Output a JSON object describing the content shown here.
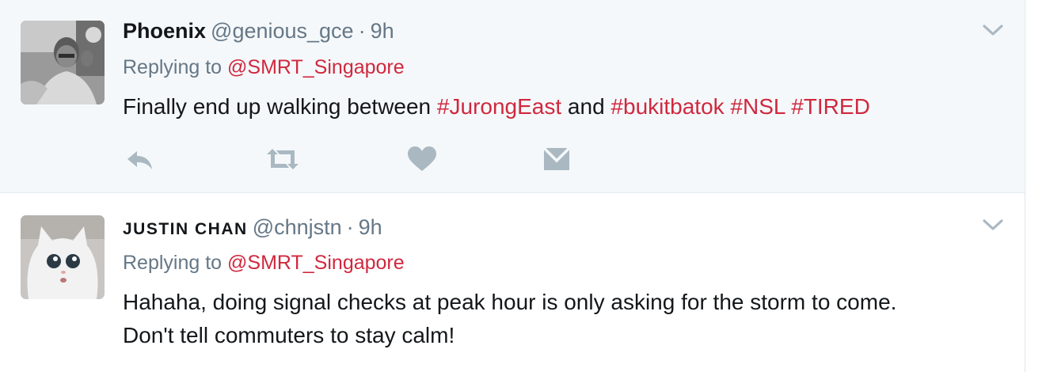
{
  "tweets": [
    {
      "fullname": "Phoenix",
      "username": "@genious_gce",
      "separator": "·",
      "time": "9h",
      "replying_prefix": "Replying to",
      "replying_to": "@SMRT_Singapore",
      "text_parts": [
        {
          "text": "Finally end up walking between ",
          "hashtag": false
        },
        {
          "text": "#JurongEast",
          "hashtag": true
        },
        {
          "text": " and ",
          "hashtag": false
        },
        {
          "text": "#bukitbatok",
          "hashtag": true
        },
        {
          "text": " ",
          "hashtag": false
        },
        {
          "text": "#NSL",
          "hashtag": true
        },
        {
          "text": " ",
          "hashtag": false
        },
        {
          "text": "#TIRED",
          "hashtag": true
        }
      ],
      "actions": [
        "reply-icon",
        "retweet-icon",
        "like-icon",
        "message-icon"
      ]
    },
    {
      "fullname": "JUSTIN CHAN",
      "username": "@chnjstn",
      "separator": "·",
      "time": "9h",
      "replying_prefix": "Replying to",
      "replying_to": "@SMRT_Singapore",
      "text_line1": "Hahaha, doing signal checks at peak hour is only asking for the storm to come.",
      "text_line2": "Don't tell commuters to stay calm!"
    }
  ],
  "colors": {
    "highlight_bg": "#f5f8fa",
    "link": "#d0283e",
    "secondary_text": "#657786",
    "icon": "#aab8c2"
  }
}
